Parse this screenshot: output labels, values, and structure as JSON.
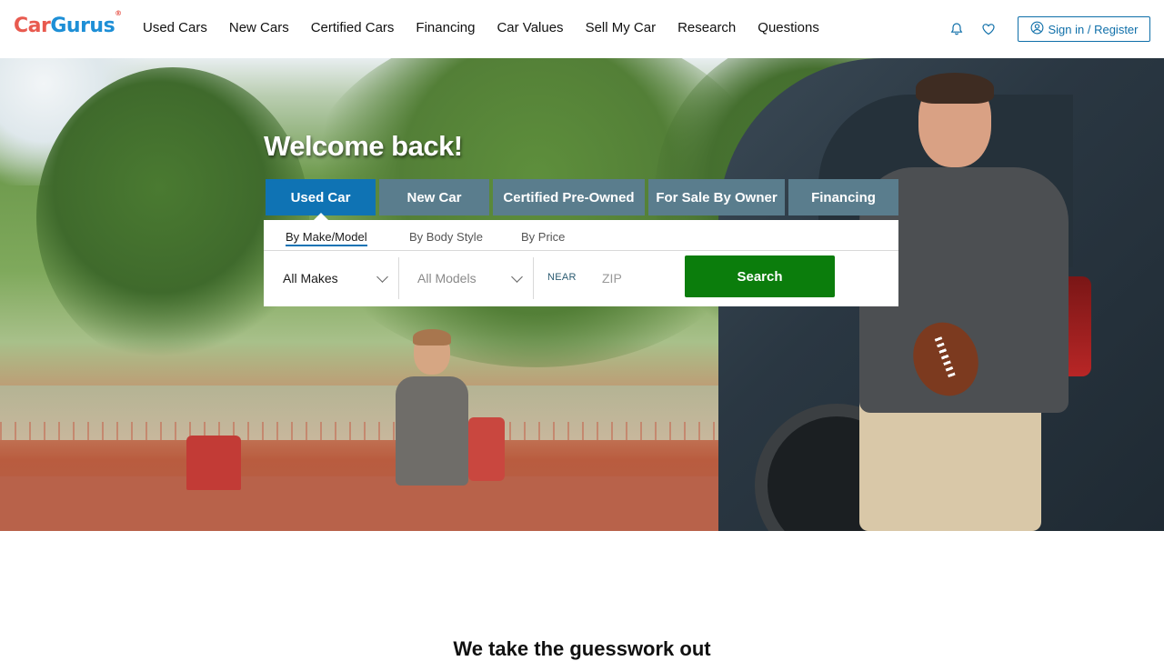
{
  "brand": {
    "logo_text_1": "Car",
    "logo_text_2": "Gurus",
    "logo_mark": "®"
  },
  "nav": {
    "items": [
      "Used Cars",
      "New Cars",
      "Certified Cars",
      "Financing",
      "Car Values",
      "Sell My Car",
      "Research",
      "Questions"
    ]
  },
  "header": {
    "notifications_icon": "bell-icon",
    "saved_icon": "heart-icon",
    "signin_label": "Sign in / Register",
    "signin_icon": "user-circle-icon"
  },
  "hero": {
    "welcome": "Welcome back!",
    "tabs": [
      {
        "label": "Used Car",
        "active": true
      },
      {
        "label": "New Car",
        "active": false
      },
      {
        "label": "Certified Pre-Owned",
        "active": false
      },
      {
        "label": "For Sale By Owner",
        "active": false
      },
      {
        "label": "Financing",
        "active": false
      }
    ],
    "subtabs": [
      {
        "label": "By Make/Model",
        "active": true
      },
      {
        "label": "By Body Style",
        "active": false
      },
      {
        "label": "By Price",
        "active": false
      }
    ],
    "make_select": "All Makes",
    "model_select": "All Models",
    "near_label": "NEAR",
    "zip_placeholder": "ZIP",
    "search_label": "Search"
  },
  "section": {
    "title": "We take the guesswork out"
  },
  "colors": {
    "primary_blue": "#0f73b4",
    "tab_inactive": "#5a7d8d",
    "search_green": "#0b7d0c",
    "logo_red": "#e85a4f",
    "logo_blue": "#1e8fd6"
  }
}
